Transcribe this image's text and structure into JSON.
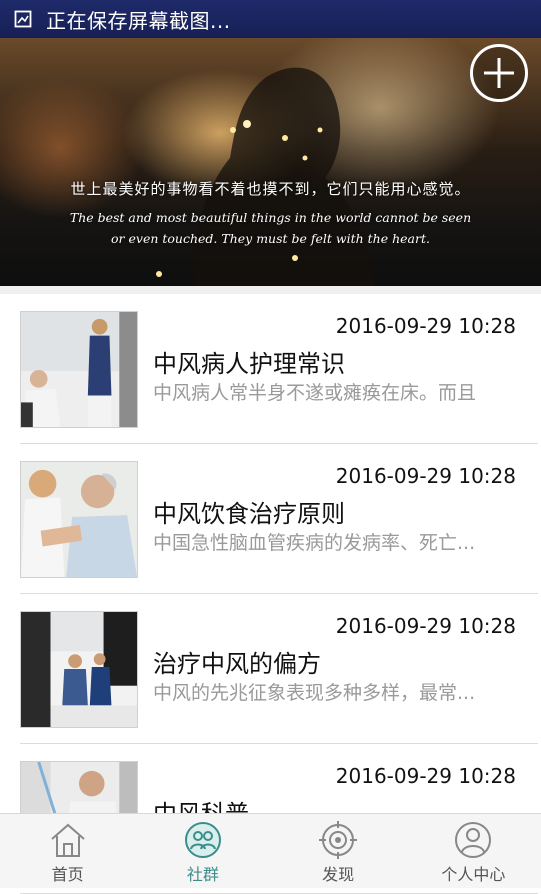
{
  "status_bar": {
    "text": "正在保存屏幕截图..."
  },
  "banner": {
    "caption_cn": "世上最美好的事物看不着也摸不到，它们只能用心感觉。",
    "caption_en_line1": "The best and most beautiful things in the world cannot be seen",
    "caption_en_line2": "or even touched. They must be felt with the heart."
  },
  "articles": [
    {
      "date": "2016-09-29 10:28",
      "title": "中风病人护理常识",
      "summary": "中风病人常半身不遂或瘫痪在床。而且"
    },
    {
      "date": "2016-09-29 10:28",
      "title": "中风饮食治疗原则",
      "summary": "中国急性脑血管疾病的发病率、死亡..."
    },
    {
      "date": "2016-09-29 10:28",
      "title": "治疗中风的偏方",
      "summary": "中风的先兆征象表现多种多样，最常..."
    },
    {
      "date": "2016-09-29 10:28",
      "title": "中风科普",
      "summary": ""
    }
  ],
  "tabs": [
    {
      "label": "首页",
      "icon": "home-icon"
    },
    {
      "label": "社群",
      "icon": "community-icon",
      "active": true
    },
    {
      "label": "发现",
      "icon": "discover-icon"
    },
    {
      "label": "个人中心",
      "icon": "profile-icon"
    }
  ],
  "colors": {
    "status_bar": "#1e2a6a",
    "active_tab": "#3b8d8b",
    "summary_text": "#9a9a9a"
  }
}
